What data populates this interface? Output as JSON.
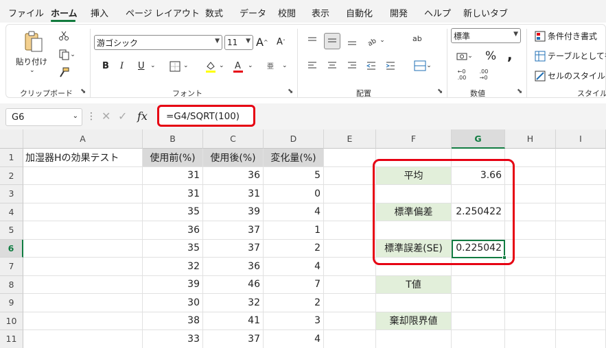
{
  "tabs": [
    "ファイル",
    "ホーム",
    "挿入",
    "ページ レイアウト",
    "数式",
    "データ",
    "校閲",
    "表示",
    "自動化",
    "開発",
    "ヘルプ",
    "新しいタブ"
  ],
  "active_tab": "ホーム",
  "ribbon": {
    "clipboard": {
      "paste_label": "貼り付け",
      "group_label": "クリップボード",
      "cut_icon": "scissors-icon",
      "copy_icon": "copy-icon",
      "format_painter_icon": "brush-icon"
    },
    "font": {
      "font_name": "游ゴシック",
      "font_size": "11",
      "bold": "B",
      "italic": "I",
      "underline": "U",
      "grow": "A",
      "shrink": "A",
      "phonetic": "亜",
      "group_label": "フォント",
      "font_color": "#e60012"
    },
    "alignment": {
      "group_label": "配置",
      "wrap_icon": "ab",
      "merge_icon": "merge-icon"
    },
    "number": {
      "format": "標準",
      "percent": "%",
      "comma": ",",
      "group_label": "数値"
    },
    "styles": {
      "conditional": "条件付き書式",
      "table": "テーブルとして書",
      "cell_styles": "セルのスタイル",
      "group_label": "スタイル"
    }
  },
  "formula_bar": {
    "name_box": "G6",
    "fx": "fx",
    "formula": "=G4/SQRT(100)"
  },
  "sheet": {
    "columns": [
      "A",
      "B",
      "C",
      "D",
      "E",
      "F",
      "G",
      "H",
      "I"
    ],
    "rows": [
      "1",
      "2",
      "3",
      "4",
      "5",
      "6",
      "7",
      "8",
      "9",
      "10",
      "11"
    ],
    "selected_column": "G",
    "selected_row": "6",
    "title": "加湿器Hの効果テスト",
    "headers": [
      "使用前(%)",
      "使用後(%)",
      "変化量(%)"
    ],
    "data": [
      [
        31,
        36,
        5
      ],
      [
        31,
        31,
        0
      ],
      [
        35,
        39,
        4
      ],
      [
        36,
        37,
        1
      ],
      [
        35,
        37,
        2
      ],
      [
        32,
        36,
        4
      ],
      [
        39,
        46,
        7
      ],
      [
        30,
        32,
        2
      ],
      [
        38,
        41,
        3
      ],
      [
        33,
        37,
        4
      ]
    ],
    "stats": [
      {
        "row": "2",
        "label": "平均",
        "value": "3.66"
      },
      {
        "row": "4",
        "label": "標準偏差",
        "value": "2.250422"
      },
      {
        "row": "6",
        "label": "標準誤差(SE)",
        "value": "0.225042"
      },
      {
        "row": "8",
        "label": "T値",
        "value": ""
      },
      {
        "row": "10",
        "label": "棄却限界値",
        "value": ""
      }
    ]
  },
  "colors": {
    "accent": "#107c41",
    "highlight": "#e60012",
    "label_fill": "#e2efda",
    "header_fill": "#d9d9d9"
  }
}
